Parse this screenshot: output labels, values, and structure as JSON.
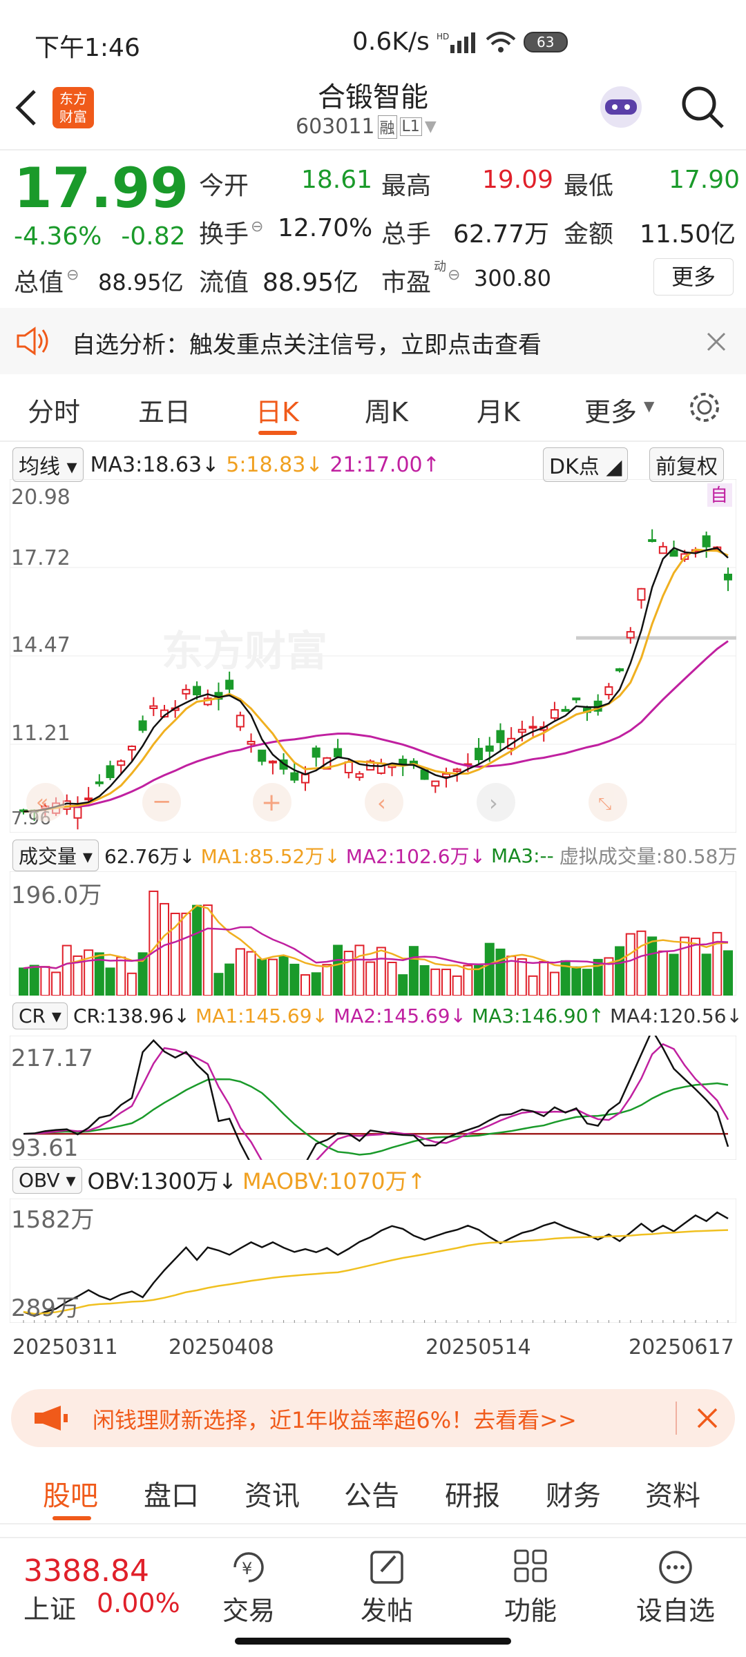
{
  "status": {
    "time": "下午1:46",
    "net": "0.6K/s",
    "battery": "63"
  },
  "header": {
    "name": "合锻智能",
    "code": "603011",
    "tag1": "融",
    "tag2": "L1",
    "logo_line1": "东方",
    "logo_line2": "财富"
  },
  "quote": {
    "price": "17.99",
    "chg_pct": "-4.36%",
    "chg": "-0.82",
    "open_l": "今开",
    "open": "18.61",
    "high_l": "最高",
    "high": "19.09",
    "low_l": "最低",
    "low": "17.90",
    "turn_l": "换手",
    "turn": "12.70%",
    "vol_l": "总手",
    "vol": "62.77万",
    "amt_l": "金额",
    "amt": "11.50亿",
    "mcap_l": "总值",
    "mcap": "88.95亿",
    "fcap_l": "流值",
    "fcap": "88.95亿",
    "pe_l": "市盈",
    "pe_sup": "动",
    "pe": "300.80",
    "more": "更多"
  },
  "notice": {
    "text": "自选分析：触发重点关注信号，立即点击查看"
  },
  "tabs": [
    "分时",
    "五日",
    "日K",
    "周K",
    "月K",
    "更多"
  ],
  "kline": {
    "ma_sel": "均线",
    "ma3": "MA3:18.63↓",
    "ma5": "5:18.83↓",
    "ma21": "21:17.00↑",
    "dk": "DK点",
    "adj": "前复权",
    "self": "自",
    "y_ticks": [
      "20.98",
      "17.72",
      "14.47",
      "11.21",
      "7.96"
    ],
    "watermark": "东方财富"
  },
  "volume": {
    "sel": "成交量",
    "v": "62.76万↓",
    "ma1": "MA1:85.52万↓",
    "ma2": "MA2:102.6万↓",
    "ma3": "MA3:--",
    "virt": "虚拟成交量:80.58万",
    "top": "196.0万"
  },
  "cr": {
    "sel": "CR",
    "v": "CR:138.96↓",
    "ma1": "MA1:145.69↓",
    "ma2": "MA2:145.69↓",
    "ma3": "MA3:146.90↑",
    "ma4": "MA4:120.56↓",
    "top": "217.17",
    "bot": "93.61"
  },
  "obv": {
    "sel": "OBV",
    "v": "OBV:1300万↓",
    "ma": "MAOBV:1070万↑",
    "top": "1582万",
    "bot": "289万"
  },
  "dates": [
    "20250311",
    "20250408",
    "20250514",
    "20250617"
  ],
  "ad": {
    "text": "闲钱理财新选择，近1年收益率超6%！去看看>>"
  },
  "bottom_tabs": [
    "股吧",
    "盘口",
    "资讯",
    "公告",
    "研报",
    "财务",
    "资料"
  ],
  "index": {
    "value": "3388.84",
    "name": "上证",
    "chg": "0.00%"
  },
  "actions": [
    "交易",
    "发帖",
    "功能",
    "设自选"
  ],
  "colors": {
    "up": "#e0202a",
    "down": "#1a9a2a",
    "accent": "#f05a1a",
    "ma5": "#f0b020",
    "ma21": "#c020a0"
  }
}
